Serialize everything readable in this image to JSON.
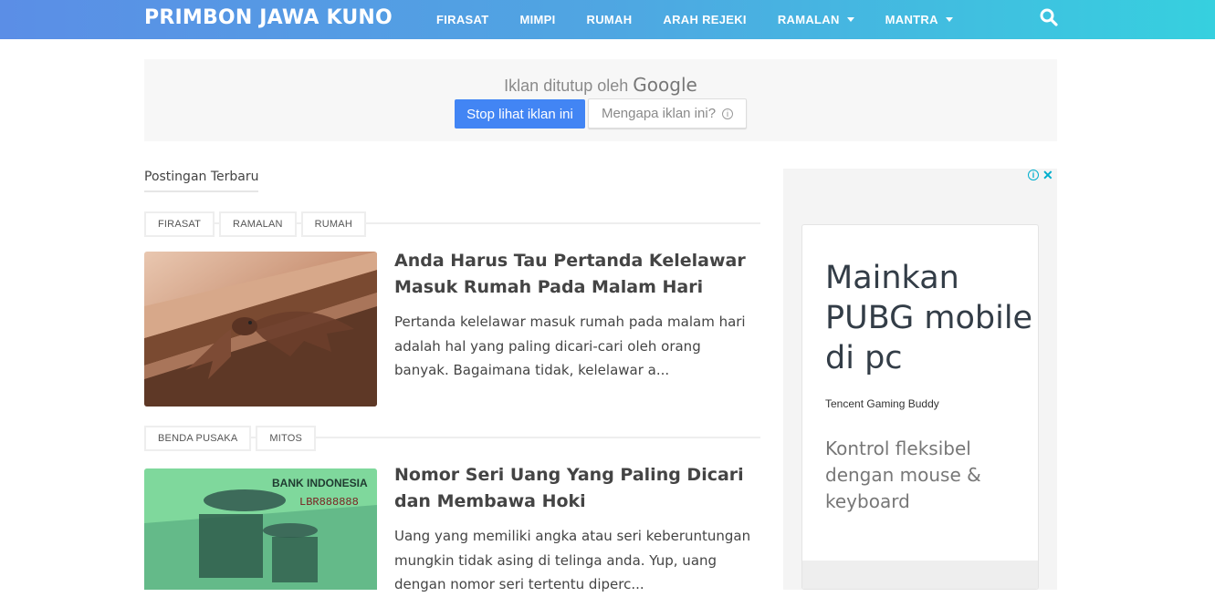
{
  "header": {
    "brand": "PRIMBON JAWA KUNO",
    "nav": [
      {
        "label": "FIRASAT"
      },
      {
        "label": "MIMPI"
      },
      {
        "label": "RUMAH"
      },
      {
        "label": "ARAH REJEKI"
      },
      {
        "label": "RAMALAN",
        "dropdown": true
      },
      {
        "label": "MANTRA",
        "dropdown": true
      }
    ],
    "search_icon": "search-icon"
  },
  "ad_closed": {
    "text": "Iklan ditutup oleh",
    "brand": "Google",
    "stop_label": "Stop lihat iklan ini",
    "why_label": "Mengapa iklan ini?",
    "stop_color": "#4285f4"
  },
  "section": {
    "title": "Postingan Terbaru"
  },
  "posts": [
    {
      "tags": [
        "FIRASAT",
        "RAMALAN",
        "RUMAH"
      ],
      "title": "Anda Harus Tau Pertanda Kelelawar Masuk Rumah Pada Malam Hari",
      "excerpt": "Pertanda kelelawar masuk rumah pada malam hari adalah hal yang paling dicari-cari oleh orang banyak. Bagaimana tidak, kelelawar a..."
    },
    {
      "tags": [
        "BENDA PUSAKA",
        "MITOS"
      ],
      "title": "Nomor Seri Uang Yang Paling Dicari dan Membawa Hoki",
      "excerpt": "Uang yang memiliki angka atau seri keberuntungan mungkin tidak asing di telinga anda. Yup, uang dengan nomor seri tertentu diperc...",
      "image_text": {
        "bank": "BANK INDONESIA",
        "serial": "LBR888888"
      }
    }
  ],
  "sidebar_ad": {
    "headline": "Mainkan PUBG mobile di pc",
    "advertiser": "Tencent Gaming Buddy",
    "body": "Kontrol fleksibel dengan mouse & keyboard",
    "accent_color": "#00aecd"
  },
  "colors": {
    "header_gradient_start": "#5b8ee6",
    "header_gradient_end": "#36d0df"
  }
}
